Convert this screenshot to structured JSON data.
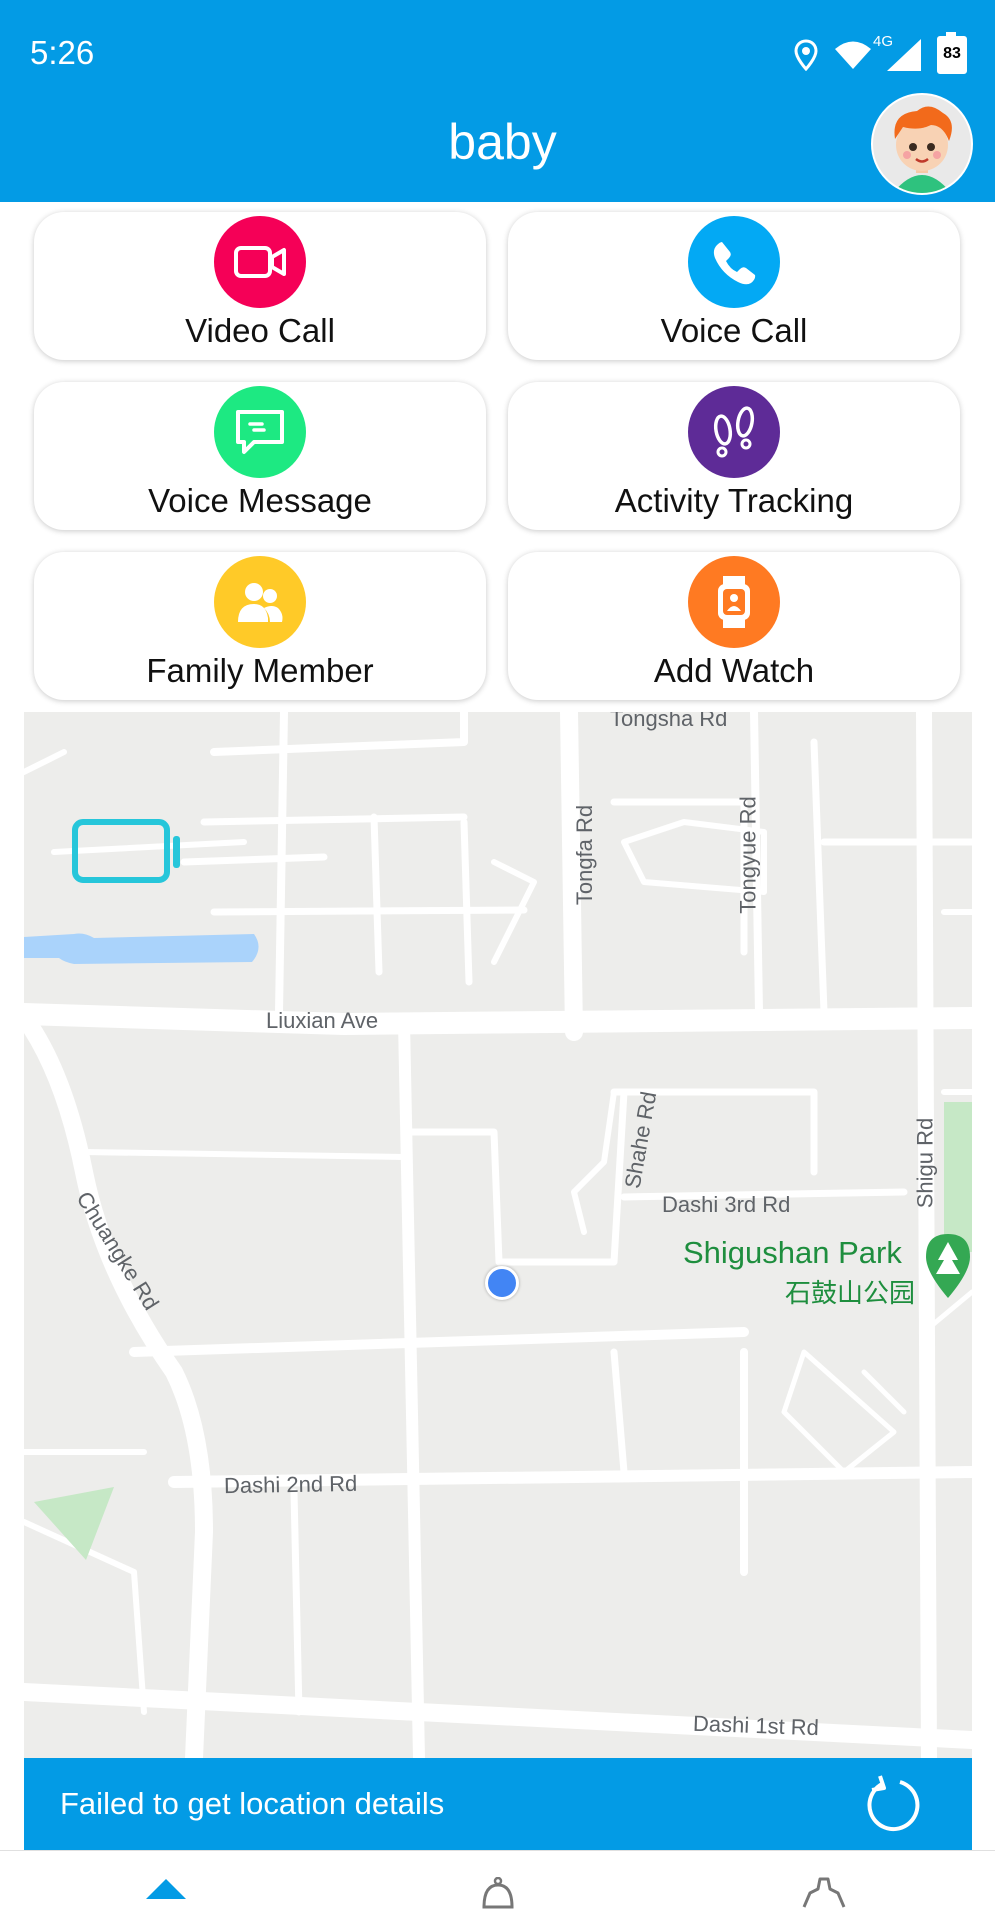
{
  "status_bar": {
    "time": "5:26",
    "network": "4G",
    "battery": "83",
    "icons": [
      "location-pin-icon",
      "wifi-icon",
      "cell-signal-icon",
      "battery-icon"
    ]
  },
  "header": {
    "title": "baby",
    "avatar_icon": "child-avatar-icon"
  },
  "features": [
    {
      "label": "Video Call",
      "icon": "video-camera-icon",
      "color": "#F50057"
    },
    {
      "label": "Voice Call",
      "icon": "phone-icon",
      "color": "#03A9F4"
    },
    {
      "label": "Voice Message",
      "icon": "chat-bubble-icon",
      "color": "#1DE982"
    },
    {
      "label": "Activity Tracking",
      "icon": "footprints-icon",
      "color": "#5E2B97"
    },
    {
      "label": "Family Member",
      "icon": "people-icon",
      "color": "#FFCA28"
    },
    {
      "label": "Add Watch",
      "icon": "watch-icon",
      "color": "#FF7A22"
    }
  ],
  "map": {
    "road_labels": {
      "tongsha": "Tongsha Rd",
      "tongfa": "Tongfa Rd",
      "tongyue": "Tongyue Rd",
      "liuxian": "Liuxian Ave",
      "shahe": "Shahe Rd",
      "shigu": "Shigu Rd",
      "dashi3": "Dashi 3rd Rd",
      "chuangke": "Chuangke Rd",
      "dashi2": "Dashi 2nd Rd",
      "dashi1": "Dashi 1st Rd"
    },
    "park_name": "Shigushan Park",
    "park_name_cn": "石鼓山公园",
    "watch_marker_icon": "watch-marker-icon",
    "location_marker": "current-location-dot"
  },
  "location_status": {
    "message": "Failed to get location details",
    "refresh_icon": "refresh-icon"
  },
  "bottom_nav": {
    "items": [
      "home-icon",
      "notification-bell-icon",
      "settings-gear-icon"
    ],
    "accent": "#039BE5"
  }
}
